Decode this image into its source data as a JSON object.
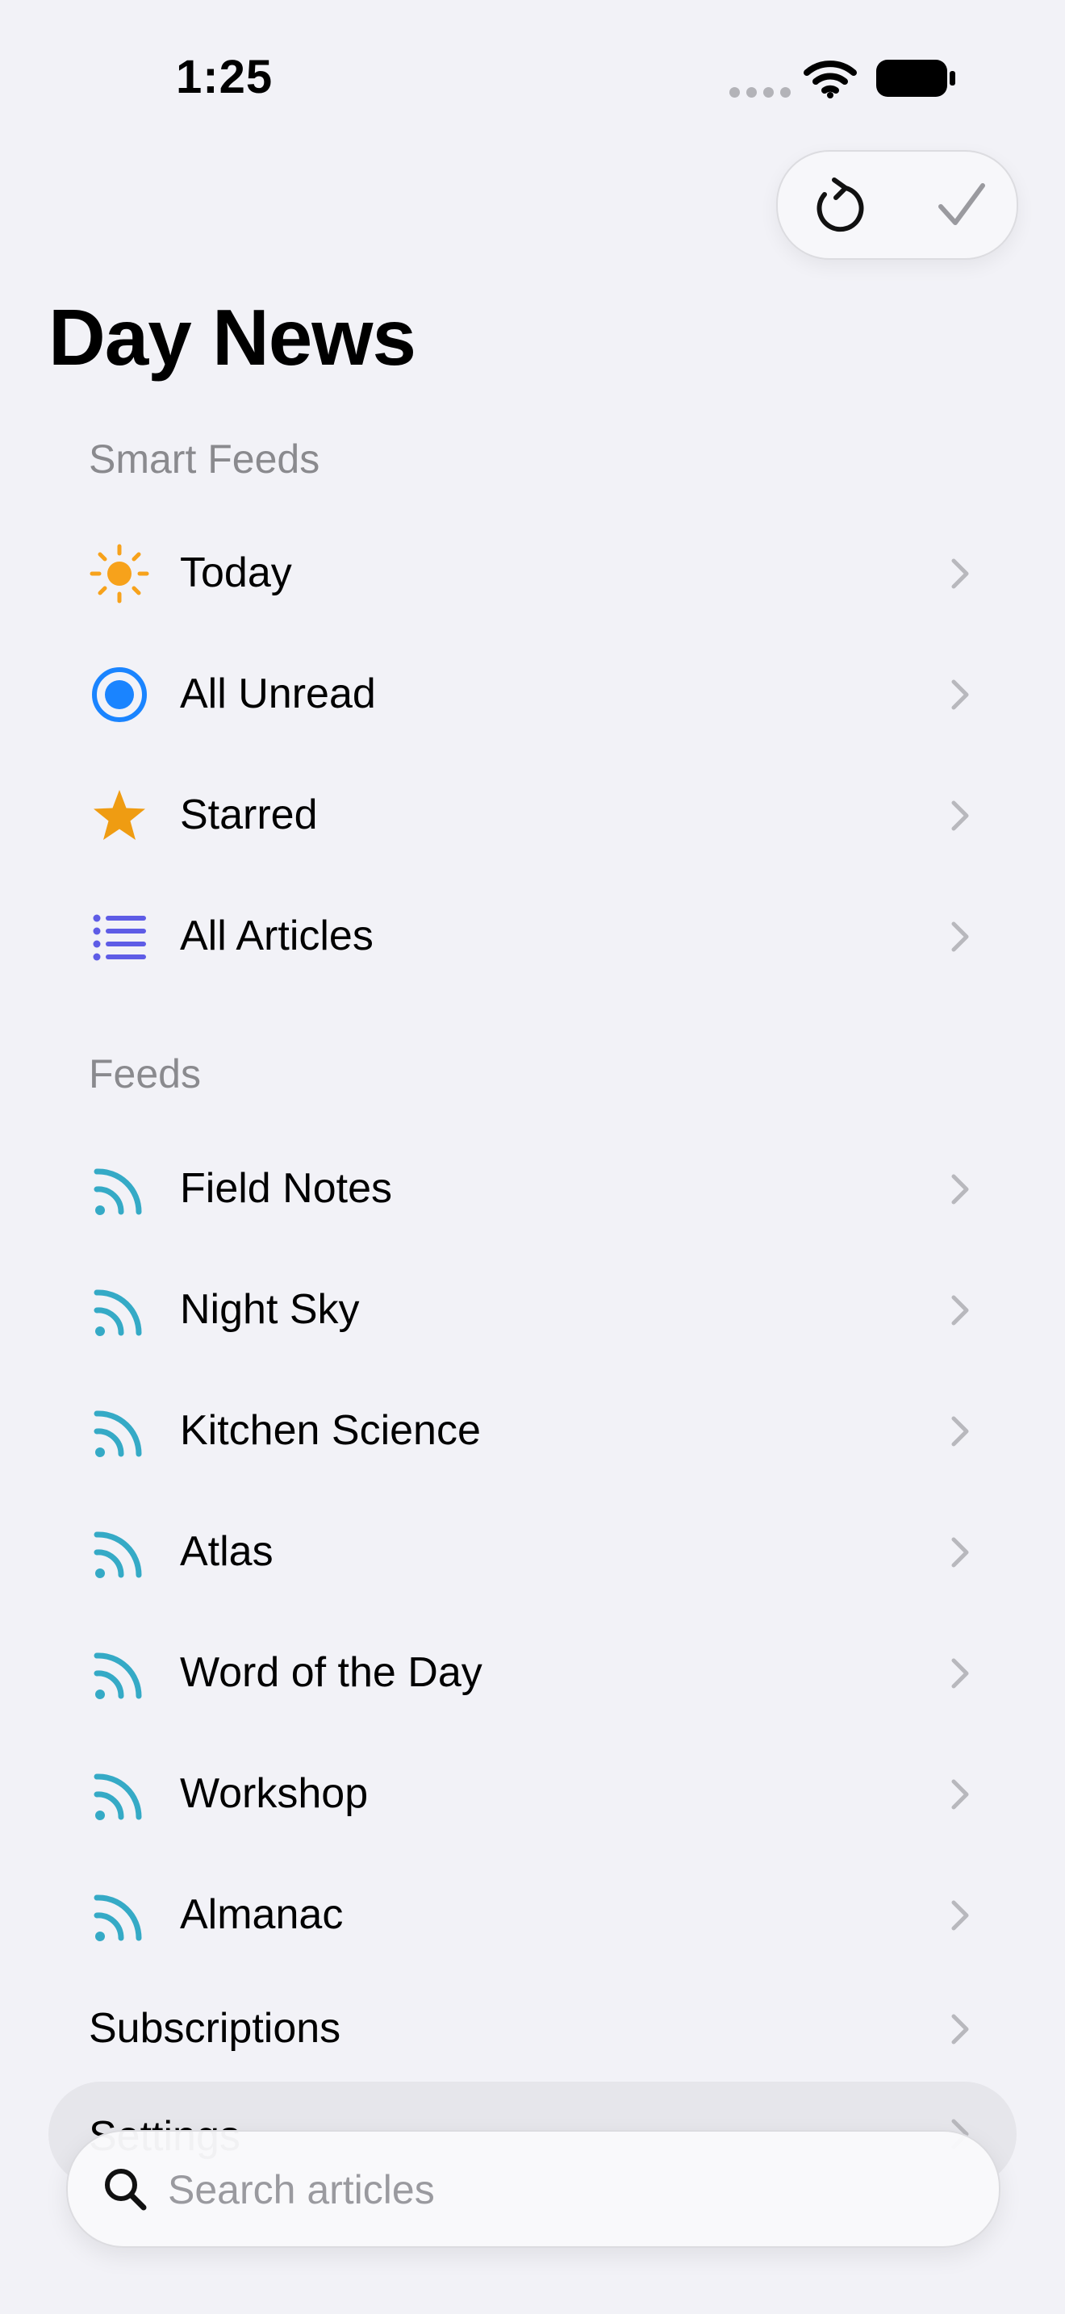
{
  "status_bar": {
    "time": "1:25"
  },
  "toolbar": {
    "refresh_icon": "refresh-icon",
    "check_icon": "checkmark-icon"
  },
  "page": {
    "title": "Day News"
  },
  "smart_feeds": {
    "header": "Smart Feeds",
    "items": [
      {
        "label": "Today",
        "icon": "sun-icon",
        "color": "#f7a21b"
      },
      {
        "label": "All Unread",
        "icon": "unread-dot-icon",
        "color": "#1a84ff"
      },
      {
        "label": "Starred",
        "icon": "star-icon",
        "color": "#ef9c12"
      },
      {
        "label": "All Articles",
        "icon": "list-icon",
        "color": "#5e5ce6"
      }
    ]
  },
  "feeds": {
    "header": "Feeds",
    "items": [
      {
        "label": "Field Notes",
        "icon": "rss-icon"
      },
      {
        "label": "Night Sky",
        "icon": "rss-icon"
      },
      {
        "label": "Kitchen Science",
        "icon": "rss-icon"
      },
      {
        "label": "Atlas",
        "icon": "rss-icon"
      },
      {
        "label": "Word of the Day",
        "icon": "rss-icon"
      },
      {
        "label": "Workshop",
        "icon": "rss-icon"
      },
      {
        "label": "Almanac",
        "icon": "rss-icon"
      }
    ],
    "rss_color": "#35aac6"
  },
  "links": {
    "subscriptions": "Subscriptions",
    "settings": "Settings"
  },
  "search": {
    "placeholder": "Search articles"
  },
  "colors": {
    "background": "#f2f2f7",
    "chevron": "#b8b8bd",
    "secondary_text": "#8a8a8e"
  }
}
